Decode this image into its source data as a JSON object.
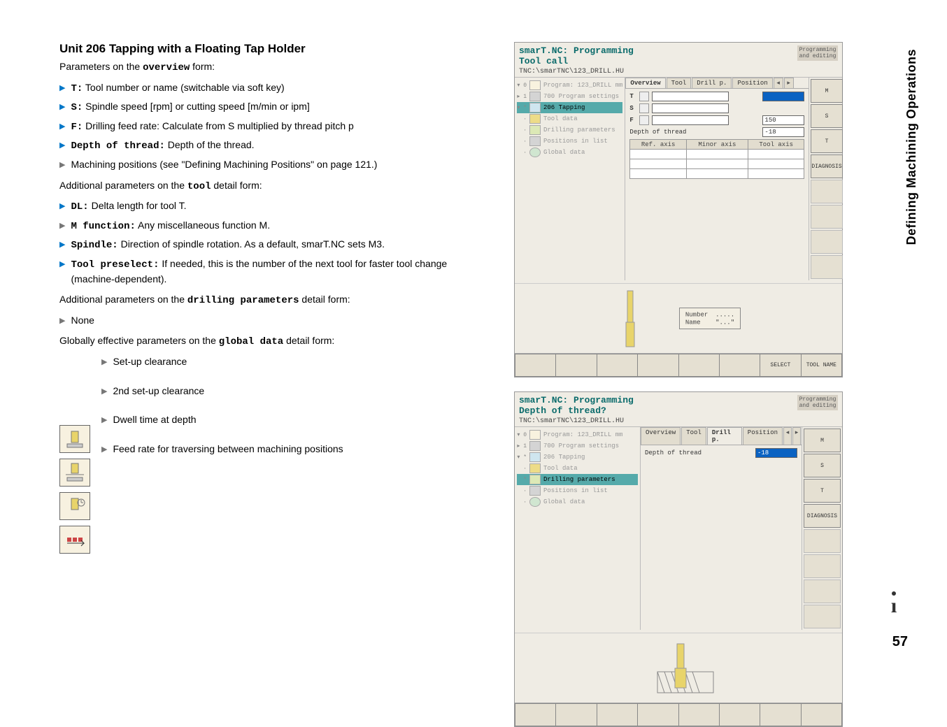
{
  "sideTab": "Defining Machining Operations",
  "pageNumber": "57",
  "heading": "Unit 206 Tapping with a Floating Tap Holder",
  "intro1_pre": "Parameters on the ",
  "intro1_b": "overview",
  "intro1_post": " form:",
  "overview": [
    {
      "b": "T:",
      "t": " Tool number or name (switchable via soft key)"
    },
    {
      "b": "S:",
      "t": " Spindle speed [rpm] or cutting speed [m/min or ipm]"
    },
    {
      "b": "F:",
      "t": " Drilling feed rate: Calculate from S multiplied by thread pitch p"
    },
    {
      "b": "Depth of thread:",
      "t": " Depth of the thread."
    },
    {
      "b": "",
      "t": "Machining positions (see \"Defining Machining Positions\" on page 121.)",
      "grey": true
    }
  ],
  "addTool_pre": "Additional parameters on the ",
  "addTool_b": "tool",
  "addTool_post": " detail form:",
  "toolParams": [
    {
      "b": "DL:",
      "t": " Delta length for tool T."
    },
    {
      "b": "M function:",
      "t": " Any miscellaneous function M.",
      "grey": true
    },
    {
      "b": "Spindle:",
      "t": " Direction of spindle rotation. As a default, smarT.NC sets M3."
    },
    {
      "b": "Tool preselect:",
      "t": " If needed, this is the number of the next tool for faster tool change (machine-dependent)."
    }
  ],
  "addDrill_pre": "Additional parameters on the ",
  "addDrill_b": "drilling parameters",
  "addDrill_post": " detail form:",
  "drillParams": [
    {
      "b": "",
      "t": "None",
      "grey": true
    }
  ],
  "global_pre": "Globally effective parameters on the ",
  "global_b": "global data",
  "global_post": " detail form:",
  "globalParams": [
    "Set-up clearance",
    "2nd set-up clearance",
    "Dwell time at depth",
    "Feed rate for traversing between machining positions"
  ],
  "shot1": {
    "title": "smarT.NC: Programming",
    "subtitle": "Tool call",
    "mode": "Programming and editing",
    "path": "TNC:\\smarTNC\\123_DRILL.HU",
    "tree": [
      {
        "n": "▾ 0",
        "t": "Program: 123_DRILL mm",
        "cls": ""
      },
      {
        "n": "▸ 1",
        "t": "700 Program settings",
        "cls": ""
      },
      {
        "n": "▾ *",
        "t": "206 Tapping",
        "cls": "darksel"
      },
      {
        "n": "·",
        "t": "Tool data",
        "cls": ""
      },
      {
        "n": "·",
        "t": "Drilling parameters",
        "cls": ""
      },
      {
        "n": "·",
        "t": "Positions in list",
        "cls": ""
      },
      {
        "n": "·",
        "t": "Global data",
        "cls": ""
      }
    ],
    "tabs": [
      "Overview",
      "Tool",
      "Drill p.",
      "Position"
    ],
    "fields": {
      "T": "",
      "S": "",
      "F": "150",
      "DepthLabel": "Depth of thread",
      "DepthVal": "-18",
      "refHeaders": [
        "Ref. axis",
        "Minor axis",
        "Tool axis"
      ]
    },
    "hintNumber": "Number",
    "hintDots": ".....",
    "hintName": "Name",
    "hintQuote": "\"...\"",
    "modeButtons": [
      "M",
      "S",
      "T",
      "DIAGNOSIS",
      "",
      "",
      "",
      ""
    ],
    "softkeys": [
      "",
      "",
      "",
      "",
      "",
      "",
      "SELECT",
      "TOOL NAME"
    ]
  },
  "shot2": {
    "title": "smarT.NC: Programming",
    "subtitle": "Depth of thread?",
    "mode": "Programming and editing",
    "path": "TNC:\\smarTNC\\123_DRILL.HU",
    "tree": [
      {
        "n": "▾ 0",
        "t": "Program: 123_DRILL mm",
        "cls": ""
      },
      {
        "n": "▸ 1",
        "t": "700 Program settings",
        "cls": ""
      },
      {
        "n": "▾ *",
        "t": "206 Tapping",
        "cls": ""
      },
      {
        "n": "·",
        "t": "Tool data",
        "cls": ""
      },
      {
        "n": "*",
        "t": "Drilling parameters",
        "cls": "darksel"
      },
      {
        "n": "·",
        "t": "Positions in list",
        "cls": ""
      },
      {
        "n": "·",
        "t": "Global data",
        "cls": ""
      }
    ],
    "tabs": [
      "Overview",
      "Tool",
      "Drill p.",
      "Position"
    ],
    "fields": {
      "DepthLabel": "Depth of thread",
      "DepthVal": "-18"
    },
    "modeButtons": [
      "M",
      "S",
      "T",
      "DIAGNOSIS",
      "",
      "",
      "",
      ""
    ],
    "softkeys": [
      "",
      "",
      "",
      "",
      "",
      "",
      "",
      ""
    ]
  }
}
